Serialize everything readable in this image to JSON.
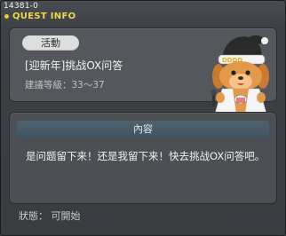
{
  "window": {
    "quest_id": "14381-0",
    "title": "QUEST INFO"
  },
  "quest": {
    "type_badge": "活動",
    "name": "[迎新年]挑战OX问答",
    "level_range": "建議等級：33～37",
    "npc_icon": "npc-dog-santa-hat-icon"
  },
  "content": {
    "header": "內容",
    "text": "是问题留下来！还是我留下来！快去挑战OX问答吧。"
  },
  "status": {
    "text": "狀態： 可開始"
  },
  "colors": {
    "title": "#f1d84a",
    "badge_bg": "#dedede",
    "content_header_bg": "#4d6270"
  }
}
